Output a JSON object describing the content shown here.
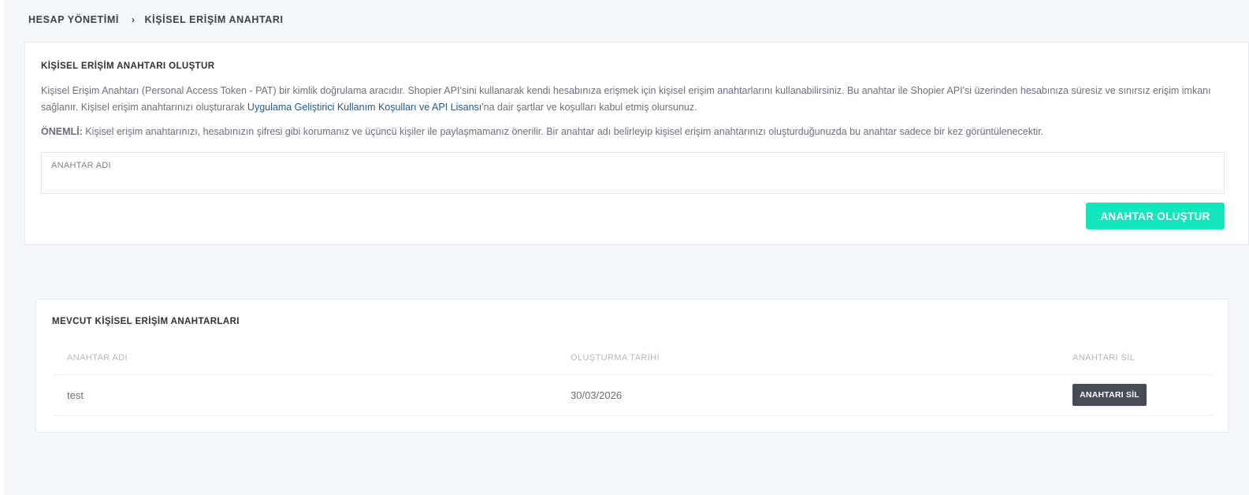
{
  "breadcrumb": {
    "root": "HESAP YÖNETİMİ",
    "separator": "›",
    "current": "KİŞİSEL ERİŞİM ANAHTARI"
  },
  "create_card": {
    "title": "KİŞİSEL ERİŞİM ANAHTARI OLUŞTUR",
    "description_before_link": "Kişisel Erişim Anahtarı (Personal Access Token - PAT) bir kimlik doğrulama aracıdır. Shopier API'sini kullanarak kendi hesabınıza erişmek için kişisel erişim anahtarlarını kullanabilirsiniz. Bu anahtar ile Shopier API'si üzerinden hesabınıza süresiz ve sınırsız erişim imkanı sağlanır. Kişisel erişim anahtarınızı oluşturarak ",
    "description_link": "Uygulama Geliştirici Kullanım Koşulları ve API Lisansı",
    "description_after_link": "'na dair şartlar ve koşulları kabul etmiş olursunuz.",
    "note_label": "ÖNEMLİ:",
    "note_text": " Kişisel erişim anahtarınızı, hesabınızın şifresi gibi korumanız ve üçüncü kişiler ile paylaşmamanız önerilir. Bir anahtar adı belirleyip kişisel erişim anahtarınızı oluşturduğunuzda bu anahtar sadece bir kez görüntülenecektir.",
    "field_label": "ANAHTAR ADI",
    "field_value": "",
    "button_label": "ANAHTAR OLUŞTUR",
    "button_color": "#11e6bd"
  },
  "list_card": {
    "title": "MEVCUT KİŞİSEL ERİŞİM ANAHTARLARI",
    "columns": [
      "ANAHTAR ADI",
      "OLUŞTURMA TARİHİ",
      "ANAHTARI SİL"
    ],
    "rows": [
      {
        "name": "test",
        "created": "30/03/2026",
        "delete_label": "ANAHTARI SİL"
      }
    ]
  }
}
